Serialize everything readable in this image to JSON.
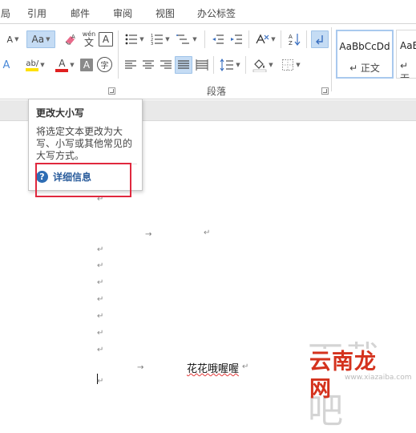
{
  "tabs": [
    "局",
    "引用",
    "邮件",
    "审阅",
    "视图",
    "办公标签"
  ],
  "font_group": {
    "change_case_label": "Aa",
    "phonetic_top": "wén",
    "phonetic_bottom": "文",
    "border_char": "A",
    "shade_char": "A",
    "circle_char": "字",
    "font_color_char": "A"
  },
  "paragraph_group": {
    "label": "段落"
  },
  "styles": [
    {
      "sample": "AaBbCcDd",
      "name": "↵ 正文"
    },
    {
      "sample": "AaB",
      "name": "↵ 无"
    }
  ],
  "tooltip": {
    "title": "更改大小写",
    "description": "将选定文本更改为大写、小写或其他常见的大写方式。",
    "help_icon": "?",
    "help_label": "详细信息"
  },
  "document": {
    "paragraph_mark": "↵",
    "tab_mark": "→",
    "body_text": "花花哦喔喔"
  },
  "watermark": {
    "big": "下载吧",
    "brand": "云南龙网",
    "url": "www.xiazaiba.com"
  },
  "colors": {
    "accent_blue": "#2e6db4",
    "highlight_red": "#e0283e",
    "font_red": "#e02020",
    "highlight_yellow": "#ffe100",
    "brand_red": "#d4321d"
  }
}
